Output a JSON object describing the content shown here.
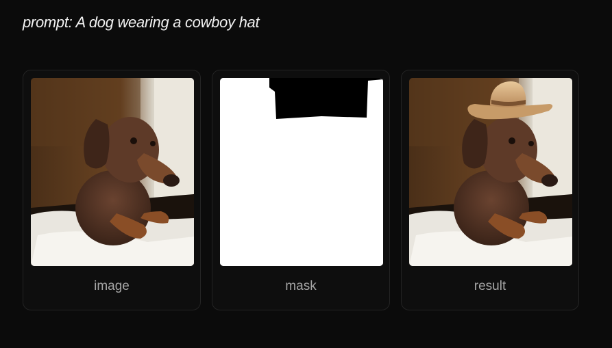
{
  "prompt": "prompt: A dog wearing a cowboy hat",
  "cards": [
    {
      "label": "image"
    },
    {
      "label": "mask"
    },
    {
      "label": "result"
    }
  ]
}
